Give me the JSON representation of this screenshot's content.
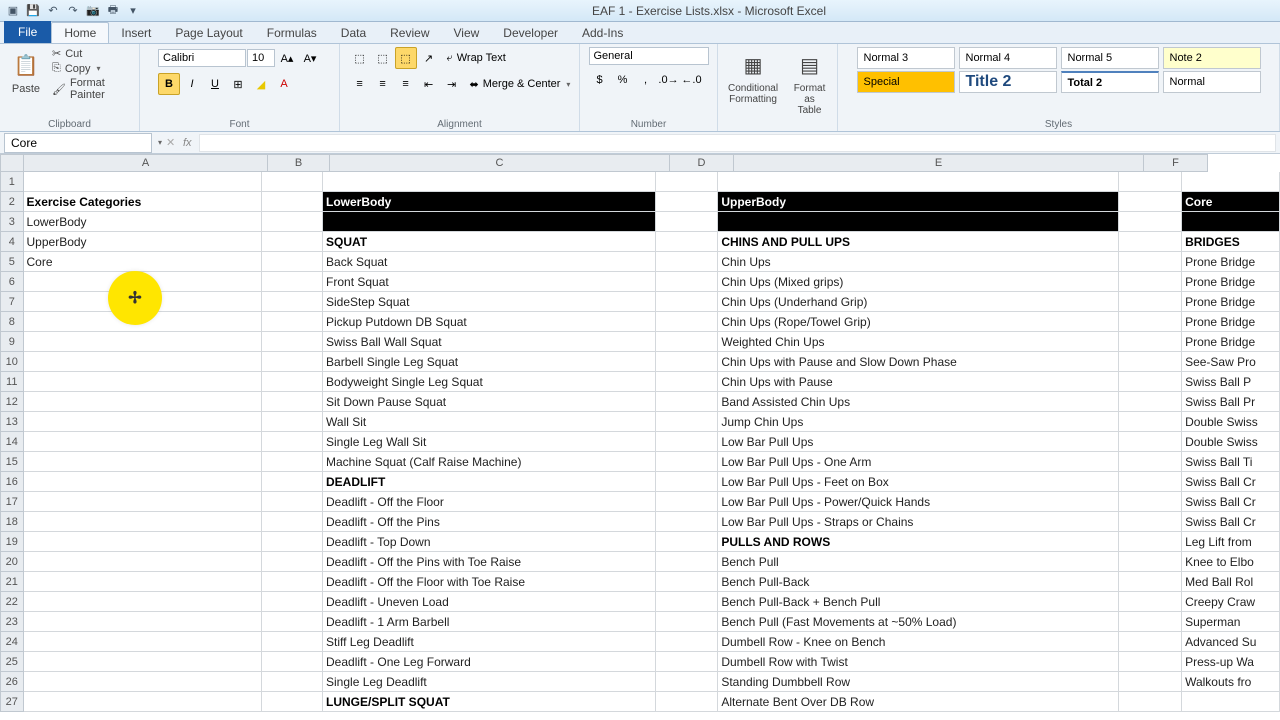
{
  "title": "EAF 1 - Exercise Lists.xlsx - Microsoft Excel",
  "tabs": {
    "file": "File",
    "home": "Home",
    "insert": "Insert",
    "layout": "Page Layout",
    "formulas": "Formulas",
    "data": "Data",
    "review": "Review",
    "view": "View",
    "developer": "Developer",
    "addins": "Add-Ins"
  },
  "clipboard": {
    "paste": "Paste",
    "cut": "Cut",
    "copy": "Copy",
    "fp": "Format Painter",
    "label": "Clipboard"
  },
  "font": {
    "name": "Calibri",
    "size": "10",
    "label": "Font"
  },
  "align": {
    "wrap": "Wrap Text",
    "merge": "Merge & Center",
    "label": "Alignment"
  },
  "number": {
    "fmt": "General",
    "label": "Number"
  },
  "cond": {
    "cf": "Conditional Formatting",
    "ft": "Format as Table"
  },
  "styles": {
    "n3": "Normal 3",
    "n4": "Normal 4",
    "n5": "Normal 5",
    "note2": "Note 2",
    "special": "Special",
    "title2": "Title 2",
    "total2": "Total 2",
    "normal": "Normal",
    "label": "Styles"
  },
  "nb": "Core",
  "cols": [
    "A",
    "B",
    "C",
    "D",
    "E",
    "F"
  ],
  "colA": {
    "h": "Exercise Categories",
    "r": [
      "LowerBody",
      "UpperBody",
      "Core"
    ]
  },
  "colC": {
    "h": "LowerBody",
    "r": [
      "SQUAT",
      "Back Squat",
      "Front Squat",
      "SideStep Squat",
      "Pickup Putdown DB Squat",
      "Swiss Ball Wall Squat",
      "Barbell Single Leg Squat",
      "Bodyweight Single Leg Squat",
      "Sit Down Pause Squat",
      "Wall Sit",
      "Single Leg Wall Sit",
      "Machine Squat (Calf Raise Machine)",
      "DEADLIFT",
      "Deadlift - Off the Floor",
      "Deadlift - Off the Pins",
      "Deadlift - Top Down",
      "Deadlift - Off the Pins with Toe Raise",
      "Deadlift - Off the Floor with Toe Raise",
      "Deadlift - Uneven Load",
      "Deadlift - 1 Arm Barbell",
      "Stiff Leg Deadlift",
      "Deadlift - One Leg Forward",
      "Single Leg Deadlift",
      "LUNGE/SPLIT SQUAT"
    ]
  },
  "colE": {
    "h": "UpperBody",
    "r": [
      "CHINS AND PULL UPS",
      "Chin Ups",
      "Chin Ups (Mixed grips)",
      "Chin Ups (Underhand Grip)",
      "Chin Ups (Rope/Towel Grip)",
      "Weighted Chin Ups",
      "Chin Ups with Pause and Slow Down Phase",
      "Chin Ups with Pause",
      "Band Assisted Chin Ups",
      "Jump Chin Ups",
      "Low Bar Pull Ups",
      "Low Bar Pull Ups - One Arm",
      "Low Bar Pull Ups - Feet on Box",
      "Low Bar Pull Ups - Power/Quick Hands",
      "Low Bar Pull Ups - Straps or Chains",
      "PULLS AND ROWS",
      "Bench Pull",
      "Bench Pull-Back",
      "Bench Pull-Back + Bench Pull",
      "Bench Pull (Fast Movements at ~50% Load)",
      "Dumbell Row - Knee on Bench",
      "Dumbell Row with Twist",
      "Standing Dumbbell Row",
      "Alternate Bent Over DB Row"
    ]
  },
  "colG": {
    "h": "Core",
    "r": [
      "BRIDGES",
      "Prone Bridge",
      "Prone Bridge",
      "Prone Bridge",
      "Prone Bridge",
      "Prone Bridge",
      "See-Saw Pro",
      "Swiss Ball P",
      "Swiss Ball Pr",
      "Double Swiss",
      "Double Swiss",
      "Swiss Ball Ti",
      "Swiss Ball Cr",
      "Swiss Ball Cr",
      "Swiss Ball Cr",
      "Leg Lift from",
      "Knee to Elbo",
      "Med Ball Rol",
      "Creepy Craw",
      "Superman",
      "Advanced Su",
      "Press-up Wa",
      "Walkouts fro",
      ""
    ]
  },
  "boldRows": [
    4,
    16,
    27,
    19
  ]
}
